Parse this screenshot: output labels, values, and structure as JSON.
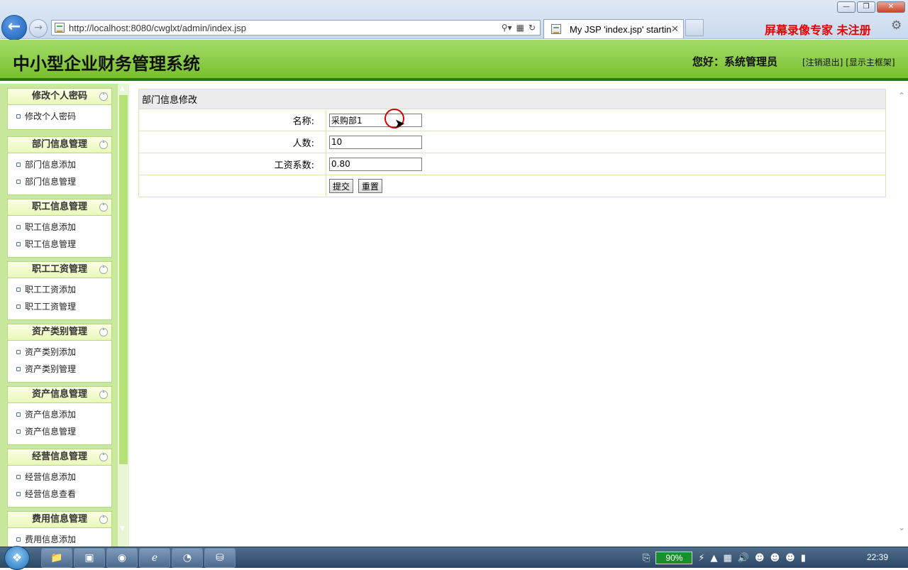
{
  "browser": {
    "url": "http://localhost:8080/cwglxt/admin/index.jsp",
    "tab_title": "My JSP 'index.jsp' startin...",
    "recorder_text": "屏幕录像专家  未注册"
  },
  "header": {
    "title": "中小型企业财务管理系统",
    "greeting": "您好：系统管理员",
    "logout": "[注销退出]",
    "show_frame": "[显示主框架]"
  },
  "sidebar": {
    "groups": [
      {
        "title": "修改个人密码",
        "items": [
          "修改个人密码"
        ]
      },
      {
        "title": "部门信息管理",
        "items": [
          "部门信息添加",
          "部门信息管理"
        ]
      },
      {
        "title": "职工信息管理",
        "items": [
          "职工信息添加",
          "职工信息管理"
        ]
      },
      {
        "title": "职工工资管理",
        "items": [
          "职工工资添加",
          "职工工资管理"
        ]
      },
      {
        "title": "资产类别管理",
        "items": [
          "资产类别添加",
          "资产类别管理"
        ]
      },
      {
        "title": "资产信息管理",
        "items": [
          "资产信息添加",
          "资产信息管理"
        ]
      },
      {
        "title": "经营信息管理",
        "items": [
          "经营信息添加",
          "经营信息查看"
        ]
      },
      {
        "title": "费用信息管理",
        "items": [
          "费用信息添加"
        ]
      }
    ]
  },
  "form": {
    "caption": "部门信息修改",
    "name_label": "名称:",
    "name_value": "采购部1",
    "count_label": "人数:",
    "count_value": "10",
    "coef_label": "工资系数:",
    "coef_value": "0.80",
    "submit_label": "提交",
    "reset_label": "重置"
  },
  "taskbar": {
    "battery": "90%",
    "clock": "22:39"
  },
  "icons": {
    "back": "arrow-left-icon",
    "forward": "arrow-right-icon",
    "search": "search-icon",
    "refresh": "refresh-icon",
    "settings": "gear-icon",
    "collapse": "chevron-up-icon"
  },
  "colors": {
    "header_green": "#78c02e",
    "sidebar_green": "#c8e89e",
    "recorder_red": "#e60000"
  }
}
